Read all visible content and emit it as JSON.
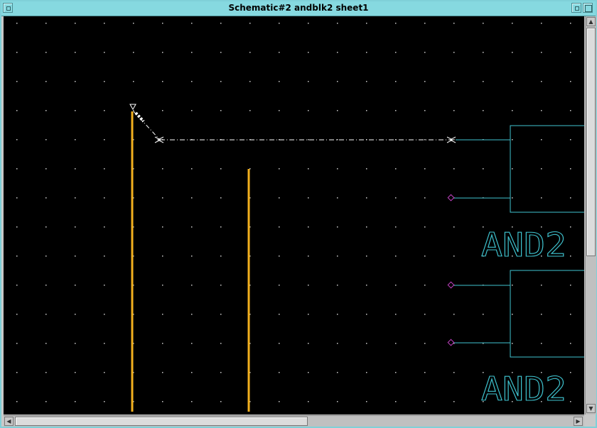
{
  "window": {
    "title": "Schematic#2 andblk2 sheet1"
  },
  "scroll": {
    "up_glyph": "▲",
    "down_glyph": "▼",
    "left_glyph": "◀",
    "right_glyph": "▶"
  },
  "schematic": {
    "gates": [
      {
        "label": "AND2"
      },
      {
        "label": "AND2"
      }
    ]
  },
  "colors": {
    "background": "#000000",
    "grid_dot": "#cccccc",
    "gate_outline": "#3fc4d0",
    "bus_line": "#f2b01e",
    "net_dashed": "#ffffff",
    "pin_marker": "#c040c0",
    "titlebar": "#86d9e0"
  },
  "icons": {
    "window_menu": "window-menu-icon",
    "minimize": "minimize-icon",
    "maximize": "maximize-icon"
  }
}
